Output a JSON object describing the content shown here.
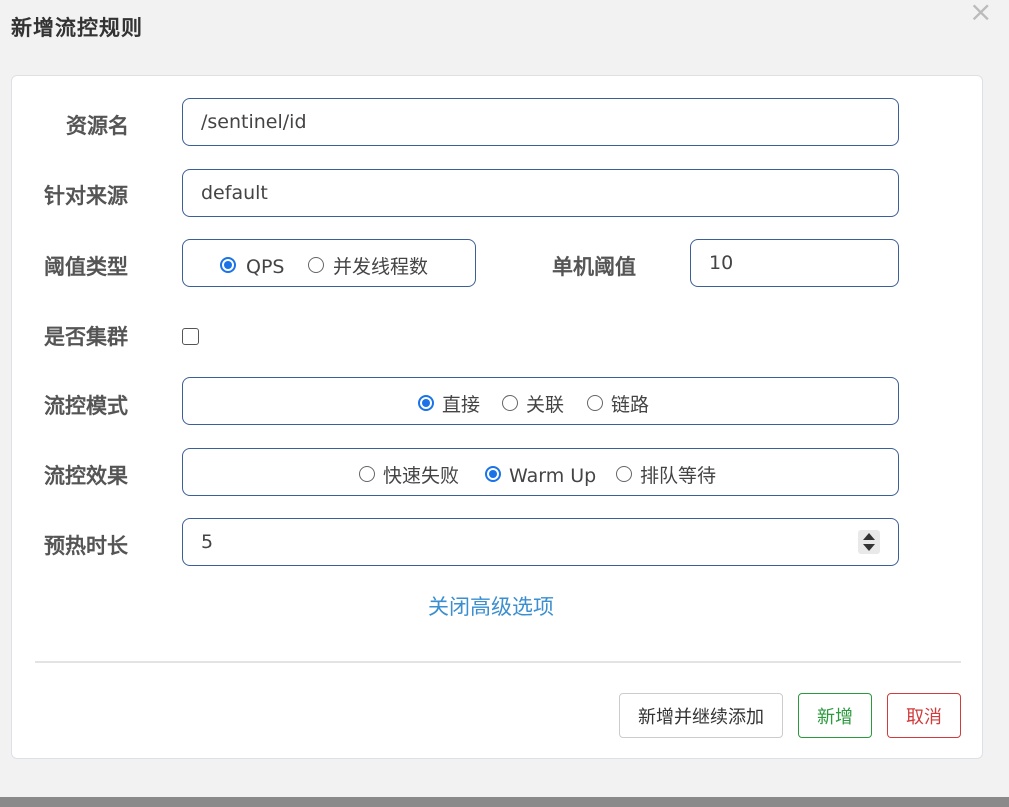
{
  "dialog": {
    "title": "新增流控规则"
  },
  "form": {
    "resource_label": "资源名",
    "resource_value": "/sentinel/id",
    "origin_label": "针对来源",
    "origin_value": "default",
    "threshold_type_label": "阈值类型",
    "threshold_type_options": [
      "QPS",
      "并发线程数"
    ],
    "threshold_type_selected": "QPS",
    "single_threshold_label": "单机阈值",
    "single_threshold_value": "10",
    "cluster_label": "是否集群",
    "cluster_checked": false,
    "control_mode_label": "流控模式",
    "control_mode_options": [
      "直接",
      "关联",
      "链路"
    ],
    "control_mode_selected": "直接",
    "control_effect_label": "流控效果",
    "control_effect_options": [
      "快速失败",
      "Warm Up",
      "排队等待"
    ],
    "control_effect_selected": "Warm Up",
    "warmup_label": "预热时长",
    "warmup_value": "5",
    "advanced_link": "关闭高级选项"
  },
  "buttons": {
    "add_continue": "新增并继续添加",
    "add": "新增",
    "cancel": "取消"
  },
  "colors": {
    "accent": "#1a73e8",
    "link": "#3b8fd0",
    "success": "#2a9a3c",
    "danger": "#d13b3b",
    "input_border": "#3b5f96"
  },
  "icons": {
    "close": "close-icon"
  }
}
